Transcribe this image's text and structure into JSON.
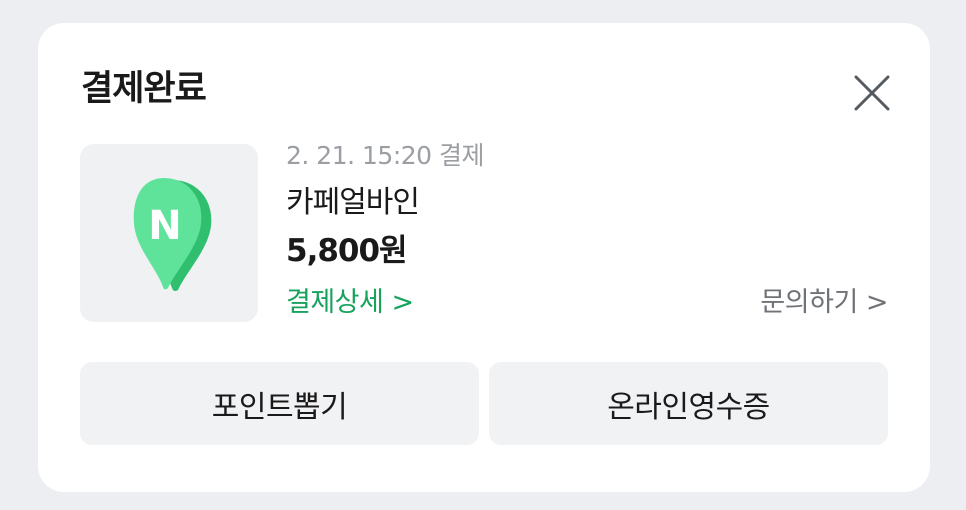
{
  "dialog": {
    "title": "결제완료",
    "close_icon": "close-icon"
  },
  "payment": {
    "paid_at": "2. 21. 15:20 결제",
    "merchant": "카페얼바인",
    "amount": "5,800원",
    "thumbnail_icon": "naver-map-pin-icon",
    "thumbnail_letter": "N",
    "detail_link": "결제상세 >",
    "inquiry_link": "문의하기 >"
  },
  "actions": {
    "points_button": "포인트뽑기",
    "receipt_button": "온라인영수증"
  },
  "colors": {
    "accent_green": "#17a35c",
    "pin_green": "#3ddc84",
    "button_bg": "#f1f2f4",
    "page_bg": "#eceef2"
  }
}
